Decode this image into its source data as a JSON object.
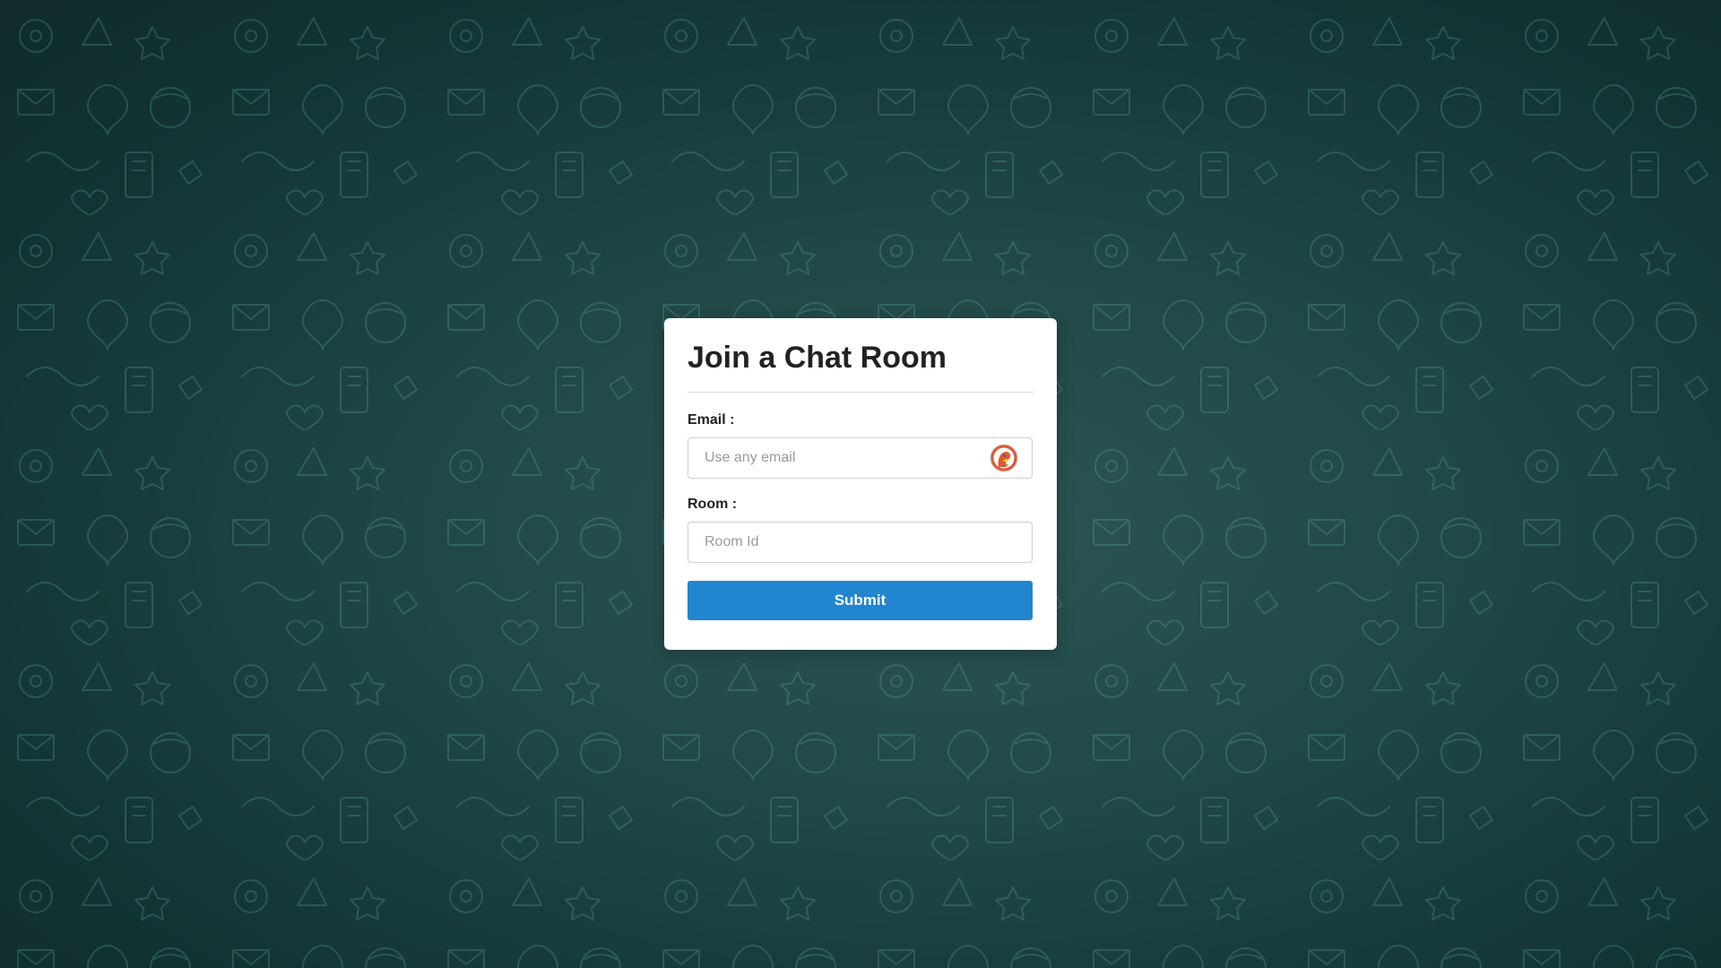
{
  "form": {
    "title": "Join a Chat Room",
    "email_label": "Email :",
    "email_placeholder": "Use any email",
    "email_value": "",
    "room_label": "Room :",
    "room_placeholder": "Room Id",
    "room_value": "",
    "submit_label": "Submit"
  },
  "icons": {
    "email_autofill": "duckduckgo-icon"
  },
  "colors": {
    "background": "#1f4746",
    "card": "#ffffff",
    "submit_button": "#2185d0",
    "title_text": "#222222"
  }
}
